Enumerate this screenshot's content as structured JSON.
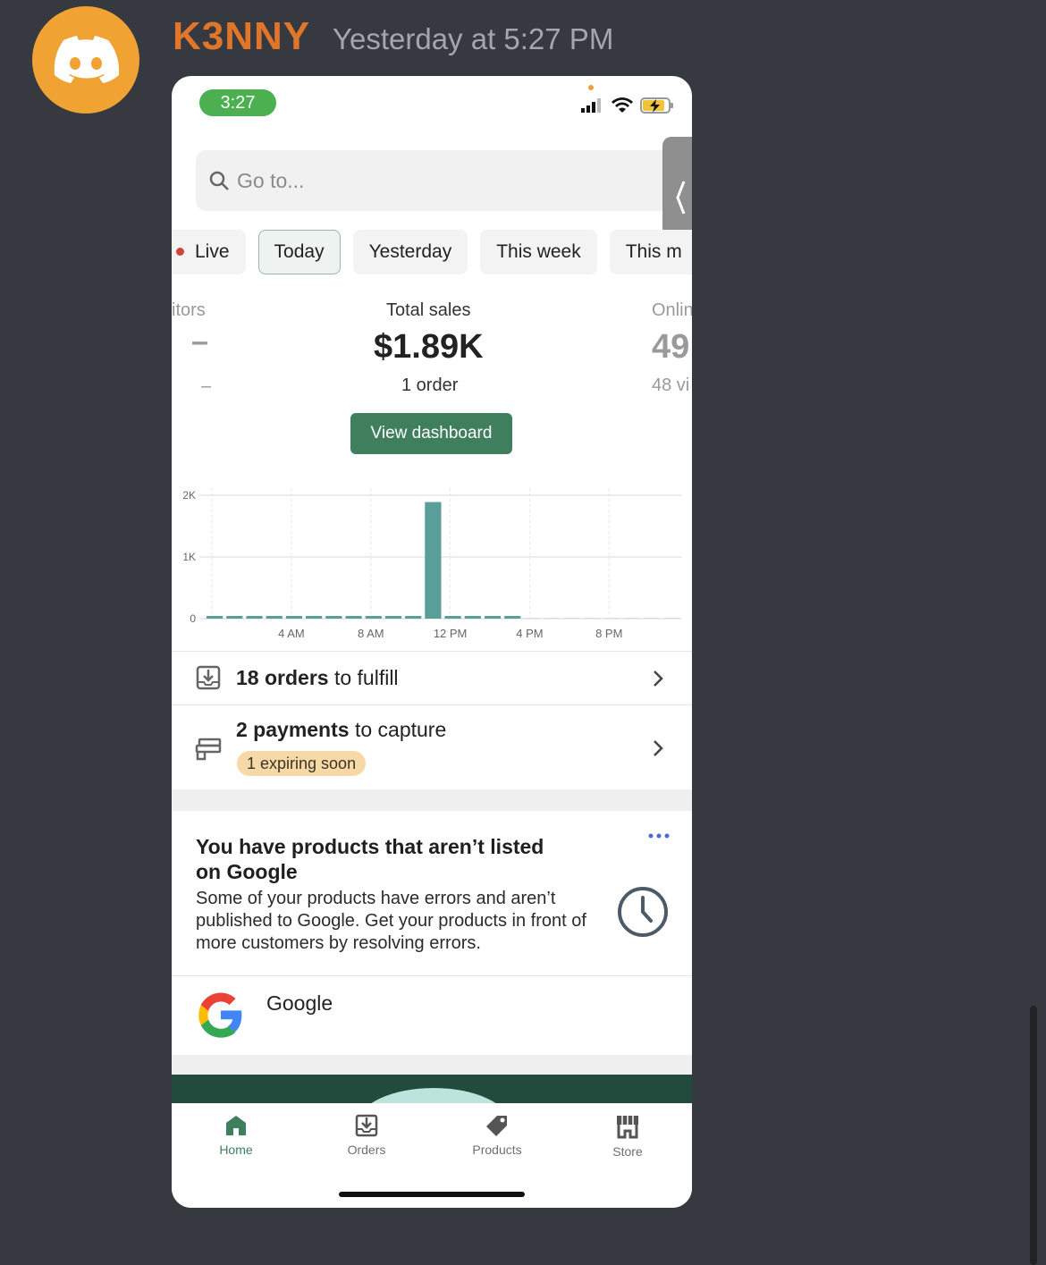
{
  "message": {
    "username": "K3NNY",
    "timestamp": "Yesterday at 5:27 PM"
  },
  "phone": {
    "status_time": "3:27",
    "search_placeholder": "Go to...",
    "chips": [
      {
        "label": "Live"
      },
      {
        "label": "Today"
      },
      {
        "label": "Yesterday"
      },
      {
        "label": "This week"
      },
      {
        "label": "This m"
      }
    ],
    "metrics": {
      "left_label": "itors",
      "left_value": "–",
      "left_sub": "–",
      "center_label": "Total sales",
      "center_value": "$1.89K",
      "center_sub": "1 order",
      "right_label": "Onlin",
      "right_value": "49",
      "right_sub": "48 vi"
    },
    "dashboard_button": "View dashboard",
    "tasks": {
      "orders_bold": "18 orders",
      "orders_rest": " to fulfill",
      "payments_bold": "2 payments",
      "payments_rest": " to capture",
      "payments_badge": "1 expiring soon"
    },
    "card": {
      "title": "You have products that aren’t listed on Google",
      "body": "Some of your products have errors and aren’t published to Google. Get your products in front of more customers by resolving errors.",
      "app_label": "Google"
    },
    "tabs": [
      {
        "label": "Home",
        "active": true
      },
      {
        "label": "Orders",
        "active": false
      },
      {
        "label": "Products",
        "active": false
      },
      {
        "label": "Store",
        "active": false
      }
    ],
    "colors": {
      "accent": "#3f7f5e",
      "bar": "#5a9e9a",
      "badge": "#f6d9a6",
      "avatar": "#f0a232",
      "username": "#e0762a"
    }
  },
  "chart_data": {
    "type": "bar",
    "y_ticks": [
      "0",
      "1K",
      "2K"
    ],
    "ylim": [
      0,
      2000
    ],
    "x_tick_labels": [
      "4 AM",
      "8 AM",
      "12 PM",
      "4 PM",
      "8 PM"
    ],
    "hours": [
      0,
      1,
      2,
      3,
      4,
      5,
      6,
      7,
      8,
      9,
      10,
      11,
      12,
      13,
      14,
      15,
      16,
      17,
      18,
      19,
      20,
      21,
      22,
      23
    ],
    "values": [
      0,
      0,
      0,
      0,
      0,
      0,
      0,
      0,
      0,
      0,
      0,
      1890,
      0,
      0,
      0,
      0,
      0,
      0,
      0,
      0,
      0,
      0,
      0,
      0
    ],
    "elapsed_hours": 16
  }
}
